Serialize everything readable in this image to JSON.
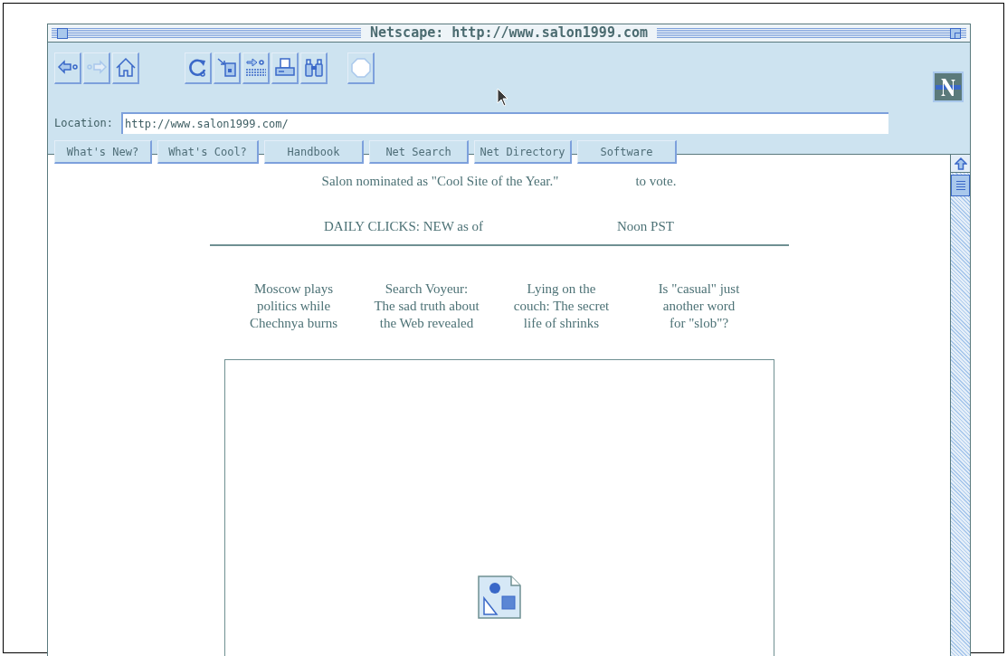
{
  "window": {
    "title": "Netscape: http://www.salon1999.com"
  },
  "toolbar": {
    "buttons": [
      {
        "kind": "back",
        "disabled": false
      },
      {
        "kind": "forward",
        "disabled": true
      },
      {
        "kind": "home",
        "disabled": false
      },
      {
        "kind": "reload",
        "disabled": false
      },
      {
        "kind": "images",
        "disabled": false
      },
      {
        "kind": "open",
        "disabled": false
      },
      {
        "kind": "print",
        "disabled": false
      },
      {
        "kind": "find",
        "disabled": false
      },
      {
        "kind": "stop",
        "disabled": true
      }
    ]
  },
  "location": {
    "label": "Location:",
    "value": "http://www.salon1999.com/"
  },
  "directory_buttons": [
    "What's New?",
    "What's Cool?",
    "Handbook",
    "Net Search",
    "Net Directory",
    "Software"
  ],
  "page": {
    "announcement": [
      "Salon nominated as \"Cool Site of the Year.\"",
      "to vote."
    ],
    "daily_clicks": [
      "DAILY CLICKS: NEW as of",
      "Noon PST"
    ],
    "stories": [
      "Moscow plays\npolitics while\nChechnya burns",
      "Search Voyeur:\nThe sad truth about\nthe Web revealed",
      "Lying on the\ncouch: The secret\nlife of shrinks",
      "Is \"casual\" just\nanother word\nfor \"slob\"?"
    ],
    "image": {
      "kind": "broken_image"
    }
  }
}
